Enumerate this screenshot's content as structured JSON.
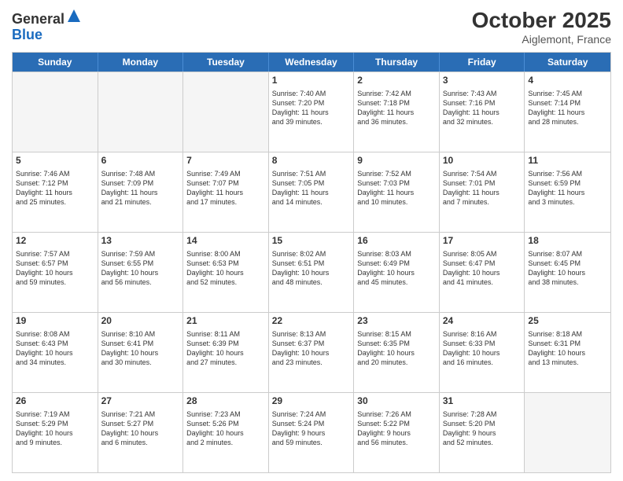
{
  "header": {
    "logo_general": "General",
    "logo_blue": "Blue",
    "month": "October 2025",
    "location": "Aiglemont, France"
  },
  "weekdays": [
    "Sunday",
    "Monday",
    "Tuesday",
    "Wednesday",
    "Thursday",
    "Friday",
    "Saturday"
  ],
  "rows": [
    [
      {
        "day": "",
        "info": ""
      },
      {
        "day": "",
        "info": ""
      },
      {
        "day": "",
        "info": ""
      },
      {
        "day": "1",
        "info": "Sunrise: 7:40 AM\nSunset: 7:20 PM\nDaylight: 11 hours\nand 39 minutes."
      },
      {
        "day": "2",
        "info": "Sunrise: 7:42 AM\nSunset: 7:18 PM\nDaylight: 11 hours\nand 36 minutes."
      },
      {
        "day": "3",
        "info": "Sunrise: 7:43 AM\nSunset: 7:16 PM\nDaylight: 11 hours\nand 32 minutes."
      },
      {
        "day": "4",
        "info": "Sunrise: 7:45 AM\nSunset: 7:14 PM\nDaylight: 11 hours\nand 28 minutes."
      }
    ],
    [
      {
        "day": "5",
        "info": "Sunrise: 7:46 AM\nSunset: 7:12 PM\nDaylight: 11 hours\nand 25 minutes."
      },
      {
        "day": "6",
        "info": "Sunrise: 7:48 AM\nSunset: 7:09 PM\nDaylight: 11 hours\nand 21 minutes."
      },
      {
        "day": "7",
        "info": "Sunrise: 7:49 AM\nSunset: 7:07 PM\nDaylight: 11 hours\nand 17 minutes."
      },
      {
        "day": "8",
        "info": "Sunrise: 7:51 AM\nSunset: 7:05 PM\nDaylight: 11 hours\nand 14 minutes."
      },
      {
        "day": "9",
        "info": "Sunrise: 7:52 AM\nSunset: 7:03 PM\nDaylight: 11 hours\nand 10 minutes."
      },
      {
        "day": "10",
        "info": "Sunrise: 7:54 AM\nSunset: 7:01 PM\nDaylight: 11 hours\nand 7 minutes."
      },
      {
        "day": "11",
        "info": "Sunrise: 7:56 AM\nSunset: 6:59 PM\nDaylight: 11 hours\nand 3 minutes."
      }
    ],
    [
      {
        "day": "12",
        "info": "Sunrise: 7:57 AM\nSunset: 6:57 PM\nDaylight: 10 hours\nand 59 minutes."
      },
      {
        "day": "13",
        "info": "Sunrise: 7:59 AM\nSunset: 6:55 PM\nDaylight: 10 hours\nand 56 minutes."
      },
      {
        "day": "14",
        "info": "Sunrise: 8:00 AM\nSunset: 6:53 PM\nDaylight: 10 hours\nand 52 minutes."
      },
      {
        "day": "15",
        "info": "Sunrise: 8:02 AM\nSunset: 6:51 PM\nDaylight: 10 hours\nand 48 minutes."
      },
      {
        "day": "16",
        "info": "Sunrise: 8:03 AM\nSunset: 6:49 PM\nDaylight: 10 hours\nand 45 minutes."
      },
      {
        "day": "17",
        "info": "Sunrise: 8:05 AM\nSunset: 6:47 PM\nDaylight: 10 hours\nand 41 minutes."
      },
      {
        "day": "18",
        "info": "Sunrise: 8:07 AM\nSunset: 6:45 PM\nDaylight: 10 hours\nand 38 minutes."
      }
    ],
    [
      {
        "day": "19",
        "info": "Sunrise: 8:08 AM\nSunset: 6:43 PM\nDaylight: 10 hours\nand 34 minutes."
      },
      {
        "day": "20",
        "info": "Sunrise: 8:10 AM\nSunset: 6:41 PM\nDaylight: 10 hours\nand 30 minutes."
      },
      {
        "day": "21",
        "info": "Sunrise: 8:11 AM\nSunset: 6:39 PM\nDaylight: 10 hours\nand 27 minutes."
      },
      {
        "day": "22",
        "info": "Sunrise: 8:13 AM\nSunset: 6:37 PM\nDaylight: 10 hours\nand 23 minutes."
      },
      {
        "day": "23",
        "info": "Sunrise: 8:15 AM\nSunset: 6:35 PM\nDaylight: 10 hours\nand 20 minutes."
      },
      {
        "day": "24",
        "info": "Sunrise: 8:16 AM\nSunset: 6:33 PM\nDaylight: 10 hours\nand 16 minutes."
      },
      {
        "day": "25",
        "info": "Sunrise: 8:18 AM\nSunset: 6:31 PM\nDaylight: 10 hours\nand 13 minutes."
      }
    ],
    [
      {
        "day": "26",
        "info": "Sunrise: 7:19 AM\nSunset: 5:29 PM\nDaylight: 10 hours\nand 9 minutes."
      },
      {
        "day": "27",
        "info": "Sunrise: 7:21 AM\nSunset: 5:27 PM\nDaylight: 10 hours\nand 6 minutes."
      },
      {
        "day": "28",
        "info": "Sunrise: 7:23 AM\nSunset: 5:26 PM\nDaylight: 10 hours\nand 2 minutes."
      },
      {
        "day": "29",
        "info": "Sunrise: 7:24 AM\nSunset: 5:24 PM\nDaylight: 9 hours\nand 59 minutes."
      },
      {
        "day": "30",
        "info": "Sunrise: 7:26 AM\nSunset: 5:22 PM\nDaylight: 9 hours\nand 56 minutes."
      },
      {
        "day": "31",
        "info": "Sunrise: 7:28 AM\nSunset: 5:20 PM\nDaylight: 9 hours\nand 52 minutes."
      },
      {
        "day": "",
        "info": ""
      }
    ]
  ]
}
